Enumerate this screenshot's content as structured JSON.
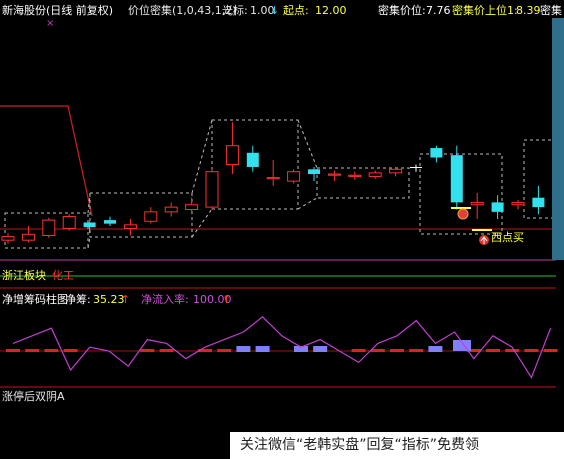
{
  "header": {
    "stock_name": "新海股份(日线 前复权)",
    "indicator": "价位密集(1,0,43,1,2)",
    "cursor_label": "光标:",
    "cursor_value": "1.00",
    "cursor_arrow": "↓",
    "start_label": "起点:",
    "start_value": "12.00",
    "dense_label": "密集价位:",
    "dense_value": "7.76",
    "upper_label": "密集价上位1:",
    "upper_value": "8.39",
    "truncated_label": "密集"
  },
  "signal": {
    "buy_label": "西点买"
  },
  "sector_row": {
    "sector": "浙江板块",
    "tag": "化工"
  },
  "net_panel": {
    "title": "净增筹码柱图",
    "net_label": "净筹:",
    "net_value": "35.23",
    "net_arrow": "↑",
    "inflow_label": "净流入率:",
    "inflow_value": "100.00",
    "inflow_arrow": "↑"
  },
  "bottom_panel": {
    "title": "涨停后双阴A"
  },
  "watermark": {
    "text": "关注微信“老韩实盘”回复“指标”免费领"
  },
  "colors": {
    "up": "#ff3030",
    "down": "#33e0ee",
    "support": "#d02020",
    "box": "#cfcfcf",
    "purple": "#c060e0",
    "green_line": "#30c030",
    "yellow": "#ffff40"
  },
  "candles": [
    {
      "o": 9.0,
      "c": 9.15,
      "h": 9.3,
      "l": 8.85
    },
    {
      "o": 9.0,
      "c": 9.25,
      "h": 9.6,
      "l": 8.9
    },
    {
      "o": 9.2,
      "c": 9.85,
      "h": 9.95,
      "l": 9.1
    },
    {
      "o": 9.5,
      "c": 10.0,
      "h": 10.1,
      "l": 9.4
    },
    {
      "o": 9.75,
      "c": 9.55,
      "h": 9.8,
      "l": 9.3
    },
    {
      "o": 9.85,
      "c": 9.7,
      "h": 10.0,
      "l": 9.6
    },
    {
      "o": 9.5,
      "c": 9.65,
      "h": 9.9,
      "l": 9.2
    },
    {
      "o": 9.8,
      "c": 10.2,
      "h": 10.4,
      "l": 9.7
    },
    {
      "o": 10.2,
      "c": 10.4,
      "h": 10.6,
      "l": 10.0
    },
    {
      "o": 10.3,
      "c": 10.5,
      "h": 10.8,
      "l": 10.1
    },
    {
      "o": 10.4,
      "c": 11.9,
      "h": 12.0,
      "l": 10.3
    },
    {
      "o": 12.2,
      "c": 13.0,
      "h": 14.0,
      "l": 11.8
    },
    {
      "o": 12.7,
      "c": 12.1,
      "h": 13.0,
      "l": 11.9
    },
    {
      "o": 11.6,
      "c": 11.65,
      "h": 12.4,
      "l": 11.3
    },
    {
      "o": 11.5,
      "c": 11.9,
      "h": 12.0,
      "l": 11.4
    },
    {
      "o": 12.0,
      "c": 11.8,
      "h": 12.1,
      "l": 11.5
    },
    {
      "o": 11.75,
      "c": 11.8,
      "h": 11.95,
      "l": 11.5
    },
    {
      "o": 11.7,
      "c": 11.75,
      "h": 11.9,
      "l": 11.55
    },
    {
      "o": 11.7,
      "c": 11.85,
      "h": 11.95,
      "l": 11.6
    },
    {
      "o": 11.85,
      "c": 12.0,
      "h": 12.1,
      "l": 11.7
    },
    {
      "o": 12.1,
      "c": 12.1,
      "h": 12.2,
      "l": 11.9
    },
    {
      "o": 12.9,
      "c": 12.5,
      "h": 13.0,
      "l": 12.3
    },
    {
      "o": 12.6,
      "c": 10.6,
      "h": 13.0,
      "l": 10.3
    },
    {
      "o": 10.5,
      "c": 10.6,
      "h": 11.0,
      "l": 9.9
    },
    {
      "o": 10.6,
      "c": 10.2,
      "h": 10.9,
      "l": 9.9
    },
    {
      "o": 10.5,
      "c": 10.6,
      "h": 10.7,
      "l": 10.3
    },
    {
      "o": 10.8,
      "c": 10.4,
      "h": 11.3,
      "l": 10.1
    },
    {
      "o": 10.9,
      "c": 11.3,
      "h": 11.4,
      "l": 10.8
    }
  ],
  "net_line": [
    0.2,
    0.4,
    0.6,
    -0.5,
    0.1,
    0.0,
    -0.4,
    0.3,
    0.2,
    -0.2,
    0.1,
    0.3,
    0.5,
    0.9,
    0.4,
    0.1,
    0.3,
    0.0,
    -0.3,
    0.2,
    0.4,
    0.8,
    0.2,
    0.5,
    -0.2,
    0.4,
    0.1,
    -0.7,
    0.6
  ],
  "net_bars": [
    -1,
    -1,
    -1,
    -1,
    0,
    0,
    0,
    -1,
    -1,
    0,
    -1,
    -1,
    1,
    1,
    0,
    1,
    1,
    0,
    -1,
    -1,
    -1,
    -1,
    1,
    0,
    -1,
    -1,
    -1,
    -1,
    -1
  ]
}
